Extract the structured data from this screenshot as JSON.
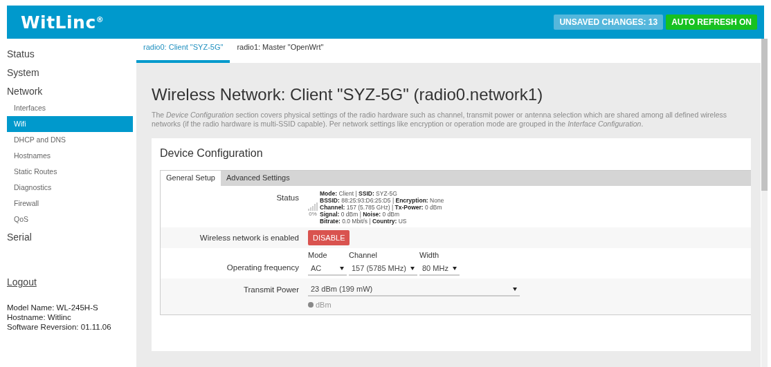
{
  "header": {
    "logo": "WitLinc$^{®}$",
    "badges": [
      {
        "text": "UNSAVED CHANGES: 13",
        "kind": "unsaved"
      },
      {
        "text": "AUTO REFRESH ON",
        "kind": "refresh"
      }
    ]
  },
  "sidebar": {
    "items": [
      {
        "label": "Status",
        "selected": false
      },
      {
        "label": "System",
        "selected": false
      },
      {
        "label": "Network",
        "selected": false,
        "children": [
          {
            "label": "Interfaces",
            "selected": false
          },
          {
            "label": "Wifi",
            "selected": true
          },
          {
            "label": "DHCP and DNS",
            "selected": false
          },
          {
            "label": "Hostnames",
            "selected": false
          },
          {
            "label": "Static Routes",
            "selected": false
          },
          {
            "label": "Diagnostics",
            "selected": false
          },
          {
            "label": "Firewall",
            "selected": false
          },
          {
            "label": "QoS",
            "selected": false
          }
        ]
      },
      {
        "label": "Serial",
        "selected": false
      }
    ],
    "logout": "Logout",
    "device_info": [
      "Model Name: WL-245H-S",
      "Hostname: Witlinc",
      "Software Reversion: 01.11.06"
    ]
  },
  "tabs": [
    {
      "label": "radio0: Client \"SYZ-5G\"",
      "selected": true
    },
    {
      "label": "radio1: Master \"OpenWrt\"",
      "selected": false
    }
  ],
  "page_title": "Wireless Network: Client \"SYZ-5G\" (radio0.network1)",
  "description": "The *Device Configuration* section covers physical settings of the radio hardware such as channel, transmit power or antenna selection which are shared among all defined wireless networks (if the radio hardware is multi-SSID capable). Per network settings like encryption or operation mode are grouped in the *Interface Configuration*.",
  "card": {
    "title": "Device Configuration",
    "tabs": [
      {
        "label": "General Setup",
        "selected": true
      },
      {
        "label": "Advanced Settings",
        "selected": false
      }
    ],
    "rows": [
      {
        "kind": "status",
        "label": "Status",
        "percent": "0%",
        "lines": [
          "**Mode:** Client | **SSID:** SYZ-5G",
          "**BSSID:** 88:25:93:D6:25:D5 | **Encryption:** None",
          "**Channel:** 157 (5.785 GHz) | **Tx-Power:** 0 dBm",
          "**Signal:** 0 dBm | **Noise:** 0 dBm",
          "**Bitrate:** 0.0 Mbit/s | **Country:** US"
        ]
      },
      {
        "kind": "toggle",
        "label": "Wireless network is enabled",
        "button": "DISABLE"
      },
      {
        "kind": "selects",
        "label": "Operating frequency",
        "selects": [
          {
            "caption": "Mode",
            "value": "AC"
          },
          {
            "caption": "Channel",
            "value": "157 (5785 MHz)"
          },
          {
            "caption": "Width",
            "value": "80 MHz"
          }
        ]
      },
      {
        "kind": "select",
        "label": "Transmit Power",
        "value": "23 dBm (199 mW)",
        "hint": "dBm"
      }
    ]
  }
}
